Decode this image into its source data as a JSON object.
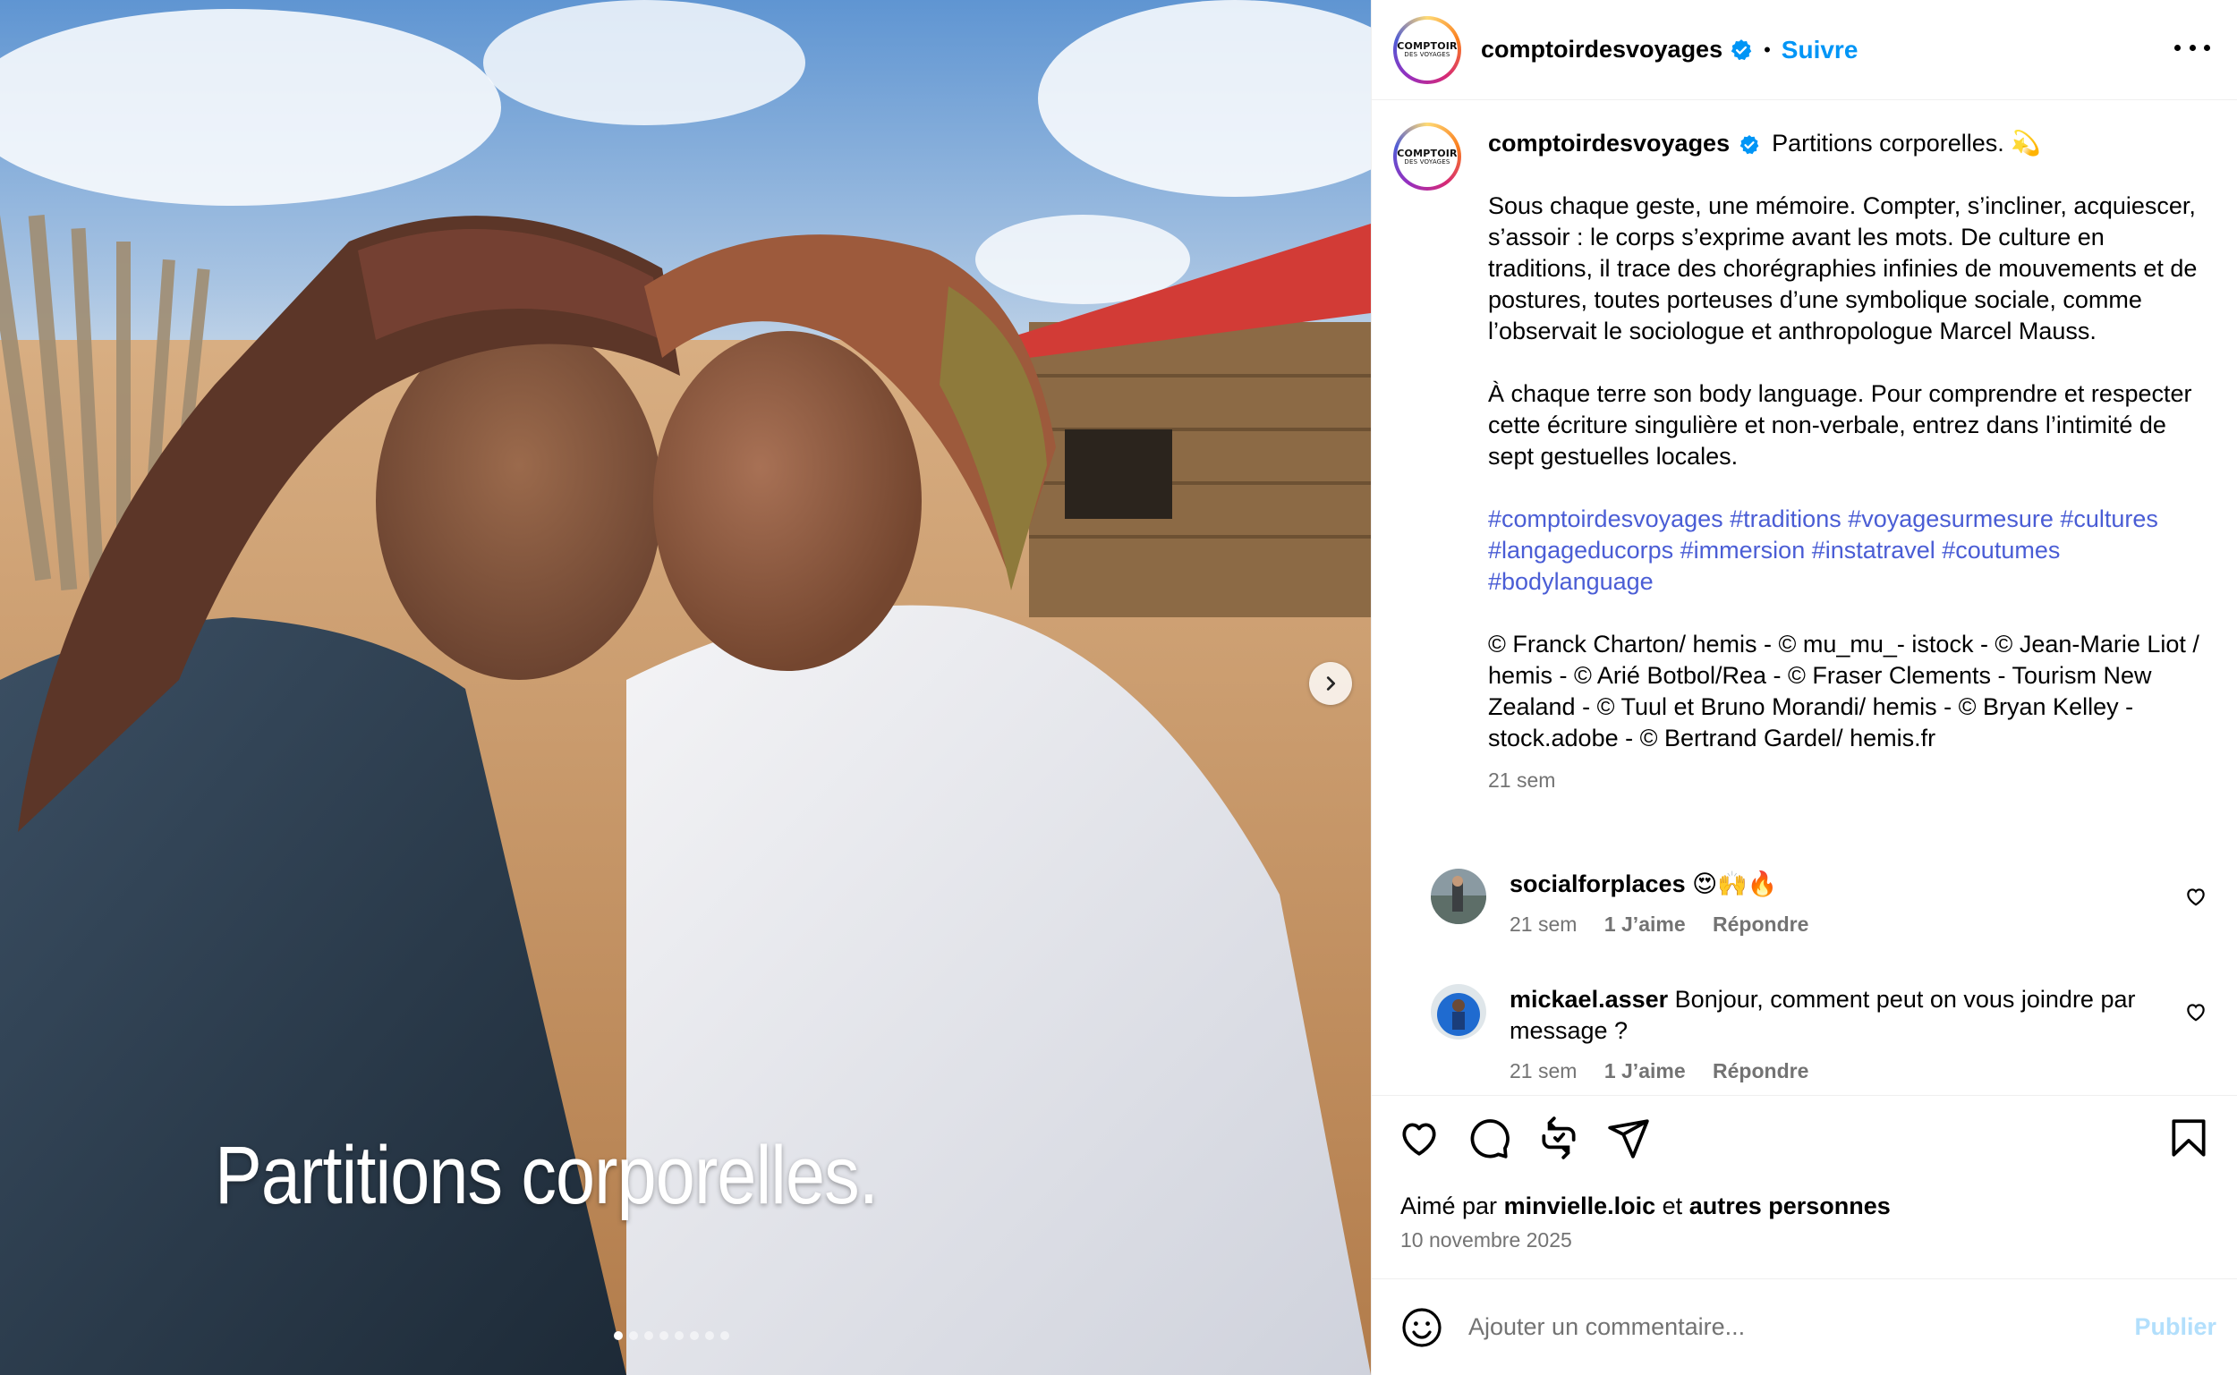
{
  "post": {
    "username": "comptoirdesvoyages",
    "follow_label": "Suivre",
    "separator": "•",
    "logo_line1": "COMPTOIR",
    "logo_line2": "DES VOYAGES"
  },
  "media": {
    "title_overlay": "Partitions corporelles.",
    "slide_count": 8,
    "active_slide": 1
  },
  "caption": {
    "username": "comptoirdesvoyages",
    "first_line": "Partitions corporelles. 💫",
    "paragraph1": "Sous chaque geste, une mémoire. Compter, s’incliner, acquiescer, s’assoir : le corps s’exprime avant les mots. De culture en traditions, il trace des chorégraphies infinies de mouvements et de postures, toutes porteuses d’une symbolique sociale, comme l’observait le sociologue et anthropologue Marcel Mauss.",
    "paragraph2": "À chaque terre son body language. Pour comprendre et respecter cette écriture singulière et non-verbale, entrez dans l’intimité de sept gestuelles locales.",
    "hashtags": "#comptoirdesvoyages #traditions #voyagesurmesure #cultures #langageducorps #immersion #instatravel #coutumes #bodylanguage",
    "credits": "© Franck Charton/ hemis - © mu_mu_- istock - © Jean-Marie Liot / hemis - © Arié Botbol/Rea - © Fraser Clements - Tourism New Zealand - © Tuul et Bruno Morandi/ hemis - © Bryan Kelley - stock.adobe - © Bertrand Gardel/ hemis.fr",
    "time": "21 sem"
  },
  "comments": [
    {
      "username": "socialforplaces",
      "text": "😍🙌🔥",
      "time": "21 sem",
      "likes": "1 J’aime",
      "reply": "Répondre"
    },
    {
      "username": "mickael.asser",
      "text": "Bonjour, comment peut on vous joindre par message ?",
      "time": "21 sem",
      "likes": "1 J’aime",
      "reply": "Répondre"
    }
  ],
  "footer": {
    "liked_by_prefix": "Aimé par",
    "liked_by_user": "minvielle.loic",
    "liked_by_and": "et",
    "liked_by_others": "autres personnes",
    "date": "10 novembre 2025",
    "comment_placeholder": "Ajouter un commentaire...",
    "publish_label": "Publier"
  },
  "colors": {
    "accent": "#0095f6",
    "hashtag": "#4a5dd5",
    "muted": "#737373",
    "publish_disabled": "#b2dffc"
  },
  "icons": {
    "verified": "verified-badge-icon",
    "more": "more-options-icon",
    "next": "chevron-right-icon",
    "like": "heart-icon",
    "comment": "comment-bubble-icon",
    "repost": "repost-icon",
    "share": "send-icon",
    "save": "bookmark-icon",
    "emoji": "emoji-icon"
  }
}
